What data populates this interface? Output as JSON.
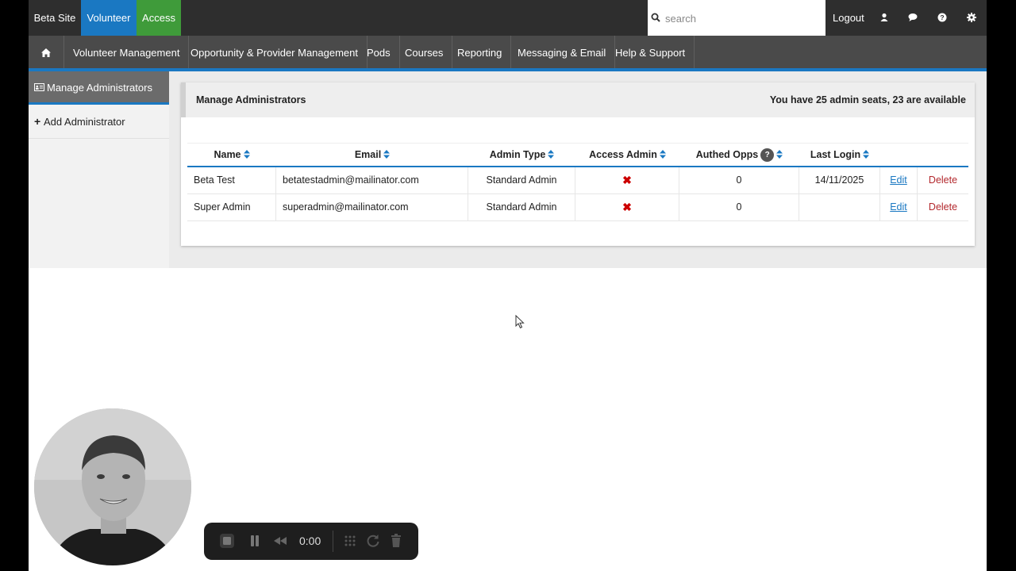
{
  "topbar": {
    "site_tabs": [
      "Beta Site",
      "Volunteer",
      "Access"
    ],
    "search_placeholder": "search",
    "logout_label": "Logout",
    "icons": [
      "user-icon",
      "chat-icon",
      "help-icon",
      "settings-icon"
    ]
  },
  "nav": {
    "items": [
      "Volunteer Management",
      "Opportunity & Provider Management",
      "Pods",
      "Courses",
      "Reporting",
      "Messaging & Email",
      "Help & Support"
    ]
  },
  "sidebar": {
    "active": "Manage Administrators",
    "add": "Add Administrator"
  },
  "panel": {
    "title": "Manage Administrators",
    "seats": "You have 25 admin seats, 23 are available"
  },
  "table": {
    "headers": [
      "Name",
      "Email",
      "Admin Type",
      "Access Admin",
      "Authed Opps",
      "Last Login"
    ],
    "help_badge": "?",
    "rows": [
      {
        "name": "Beta Test",
        "email": "betatestadmin@mailinator.com",
        "type": "Standard Admin",
        "access_admin": "✖",
        "authed_opps": "0",
        "last_login": "14/11/2025",
        "edit": "Edit",
        "delete": "Delete"
      },
      {
        "name": "Super Admin",
        "email": "superadmin@mailinator.com",
        "type": "Standard Admin",
        "access_admin": "✖",
        "authed_opps": "0",
        "last_login": "",
        "edit": "Edit",
        "delete": "Delete"
      }
    ]
  },
  "recorder": {
    "time": "0:00"
  },
  "colors": {
    "accent_blue": "#1a78c2",
    "access_green": "#3f9b3a",
    "delete_red": "#b3282d"
  }
}
